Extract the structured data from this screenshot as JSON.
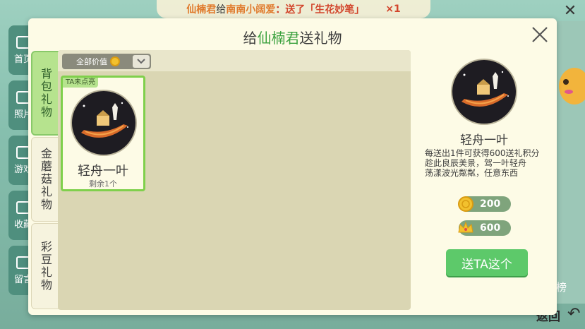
{
  "banner": {
    "sender": "仙楠君",
    "verb": "给",
    "receiver": "南南小阔爱",
    "sent_text": "：送了「生花妙笔」",
    "count": "×1"
  },
  "background_nav": [
    {
      "label": "首页",
      "icon": "home-icon"
    },
    {
      "label": "照片",
      "icon": "photo-icon"
    },
    {
      "label": "游戏",
      "icon": "game-icon"
    },
    {
      "label": "收藏",
      "icon": "star-icon"
    },
    {
      "label": "留言",
      "icon": "message-icon"
    }
  ],
  "background_misc": {
    "rank_label": "榜",
    "back_label": "返回"
  },
  "dialog": {
    "title_prefix": "给",
    "title_name": "仙楠君",
    "title_suffix": "送礼物",
    "tabs": [
      {
        "label": "背包礼物",
        "active": true
      },
      {
        "label": "金蘑菇礼物",
        "active": false
      },
      {
        "label": "彩豆礼物",
        "active": false
      }
    ],
    "filter": {
      "label": "全部价值",
      "icon": "coin-icon"
    },
    "gifts": [
      {
        "name": "轻舟一叶",
        "tag": "TA未点亮",
        "remaining": "剩余1个",
        "icon": "boat-gift-icon",
        "selected": true
      }
    ],
    "detail": {
      "name": "轻舟一叶",
      "desc_line1": "每送出1件可获得600送礼积分",
      "desc_line2": "趁此良辰美景，驾一叶轻舟",
      "desc_line3": "荡漾波光粼粼，任意东西",
      "prices": [
        {
          "icon": "coin-icon",
          "value": "200"
        },
        {
          "icon": "crown-icon",
          "value": "600"
        }
      ],
      "send_label": "送TA这个"
    }
  },
  "colors": {
    "accent_green": "#5dc96a",
    "highlight_name": "#3ca23f",
    "panel_bg": "#fdfbe6"
  }
}
